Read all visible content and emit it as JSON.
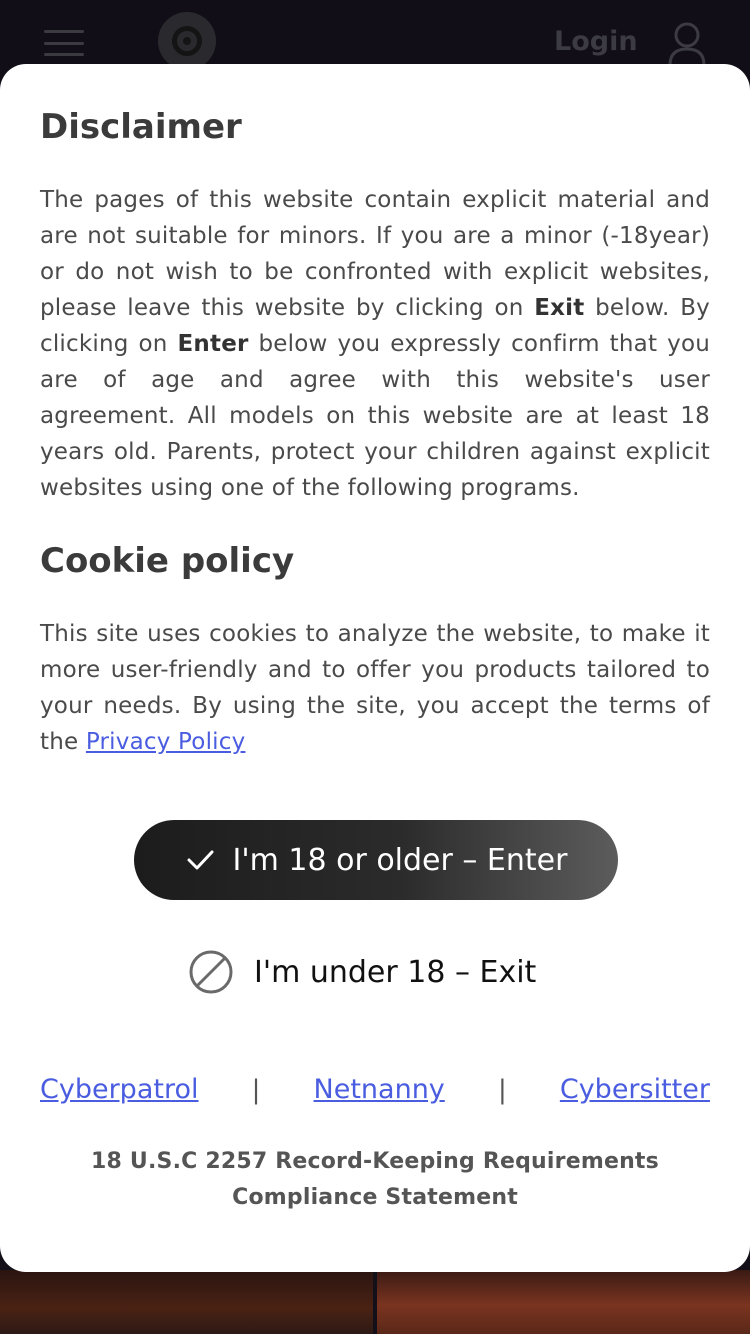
{
  "header": {
    "login_label": "Login"
  },
  "disclaimer": {
    "title": "Disclaimer",
    "text_part1": "The pages of this website contain explicit material and are not suitable for minors. If you are a minor (-18year) or do not wish to be confronted with explicit websites, please leave this website by clicking on ",
    "exit_word": "Exit",
    "text_part2": " below. By clicking on ",
    "enter_word": "Enter",
    "text_part3": " below you expressly confirm that you are of age and agree with this website's user agreement. All models on this website are at least 18 years old. Parents, protect your children against explicit websites using one of the following programs."
  },
  "cookie": {
    "title": "Cookie policy",
    "text": "This site uses cookies to analyze the website, to make it more user-friendly and to offer you products tailored to your needs. By using the site, you accept the terms of the ",
    "privacy_link": "Privacy Policy"
  },
  "actions": {
    "enter_label": "I'm 18 or older – Enter",
    "exit_label": "I'm under 18 – Exit"
  },
  "filters": {
    "items": [
      "Cyberpatrol",
      "Netnanny",
      "Cybersitter"
    ],
    "separator": "|"
  },
  "compliance": {
    "text": "18 U.S.C 2257 Record-Keeping Requirements Compliance Statement"
  },
  "colors": {
    "link": "#4a5de0",
    "background": "#14101a",
    "enter_button_start": "#1c1c1c",
    "enter_button_end": "#5c5c5c"
  },
  "icons": {
    "menu": "hamburger-menu-icon",
    "logo": "site-logo-icon",
    "user": "user-icon",
    "enter": "check-icon",
    "exit": "block-icon"
  }
}
